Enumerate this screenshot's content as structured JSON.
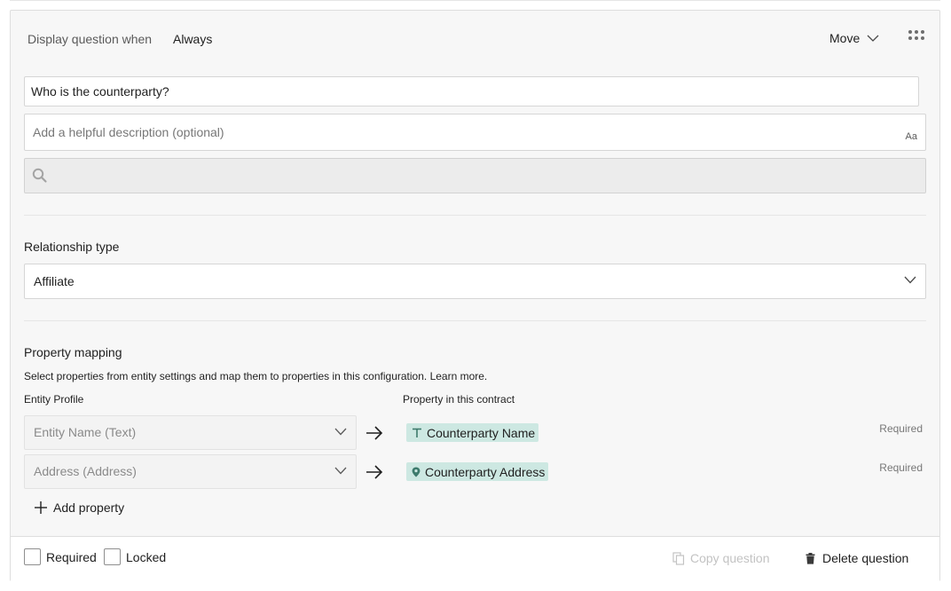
{
  "header": {
    "display_label": "Display question when",
    "display_value": "Always",
    "move_label": "Move",
    "more_icon": "more-grid-icon"
  },
  "question": {
    "title_value": "Who is the counterparty?",
    "description_placeholder": "Add a helpful description (optional)",
    "format_label": "Aa",
    "search_value": ""
  },
  "relationship": {
    "title": "Relationship type",
    "selected": "Affiliate"
  },
  "mapping": {
    "title": "Property mapping",
    "description": "Select properties from entity settings and map them to properties in this configuration. Learn more.",
    "col_entity": "Entity Profile",
    "col_property": "Property in this contract",
    "rows": [
      {
        "entity": "Entity Name (Text)",
        "property": "Counterparty Name",
        "property_icon": "text-type-icon",
        "required": "Required"
      },
      {
        "entity": "Address (Address)",
        "property": "Counterparty Address",
        "property_icon": "location-pin-icon",
        "required": "Required"
      }
    ],
    "add_label": "Add property"
  },
  "footer": {
    "required_label": "Required",
    "locked_label": "Locked",
    "copy_label": "Copy question",
    "delete_label": "Delete question"
  },
  "colors": {
    "chip_bg": "#cde8e2",
    "chip_icon": "#3d7a6c",
    "disabled_text": "#c3c3c3"
  }
}
